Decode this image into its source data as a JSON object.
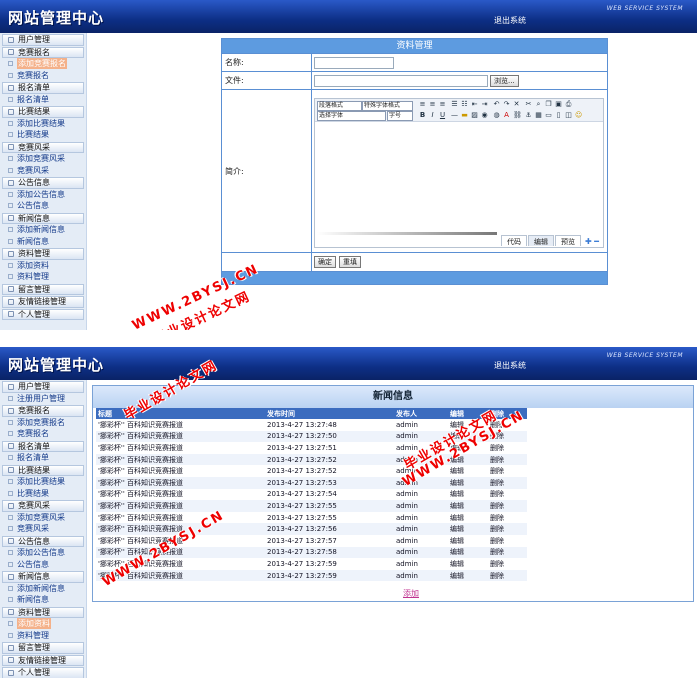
{
  "header": {
    "title": "网站管理中心",
    "logout": "退出系统",
    "system": "WEB SERVICE SYSTEM"
  },
  "sidebar_top": [
    {
      "type": "group",
      "label": "用户管理"
    },
    {
      "type": "group",
      "label": "竞赛报名"
    },
    {
      "type": "link",
      "label": "添加竞赛报名",
      "active": true
    },
    {
      "type": "link",
      "label": "竞赛报名"
    },
    {
      "type": "group",
      "label": "报名清单"
    },
    {
      "type": "link",
      "label": "报名清单"
    },
    {
      "type": "group",
      "label": "比赛结果"
    },
    {
      "type": "link",
      "label": "添加比赛结果"
    },
    {
      "type": "link",
      "label": "比赛结果"
    },
    {
      "type": "group",
      "label": "竞赛风采"
    },
    {
      "type": "link",
      "label": "添加竞赛风采"
    },
    {
      "type": "link",
      "label": "竞赛风采"
    },
    {
      "type": "group",
      "label": "公告信息"
    },
    {
      "type": "link",
      "label": "添加公告信息"
    },
    {
      "type": "link",
      "label": "公告信息"
    },
    {
      "type": "group",
      "label": "新闻信息"
    },
    {
      "type": "link",
      "label": "添加新闻信息"
    },
    {
      "type": "link",
      "label": "新闻信息"
    },
    {
      "type": "group",
      "label": "资料管理"
    },
    {
      "type": "link",
      "label": "添加资料"
    },
    {
      "type": "link",
      "label": "资料管理"
    },
    {
      "type": "group",
      "label": "留言管理"
    },
    {
      "type": "group",
      "label": "友情链接管理"
    },
    {
      "type": "group",
      "label": "个人管理"
    }
  ],
  "sidebar_bottom": [
    {
      "type": "group",
      "label": "用户管理"
    },
    {
      "type": "link",
      "label": "注册用户管理"
    },
    {
      "type": "group",
      "label": "竞赛报名"
    },
    {
      "type": "link",
      "label": "添加竞赛报名"
    },
    {
      "type": "link",
      "label": "竞赛报名"
    },
    {
      "type": "group",
      "label": "报名清单"
    },
    {
      "type": "link",
      "label": "报名清单"
    },
    {
      "type": "group",
      "label": "比赛结果"
    },
    {
      "type": "link",
      "label": "添加比赛结果"
    },
    {
      "type": "link",
      "label": "比赛结果"
    },
    {
      "type": "group",
      "label": "竞赛风采"
    },
    {
      "type": "link",
      "label": "添加竞赛风采"
    },
    {
      "type": "link",
      "label": "竞赛风采"
    },
    {
      "type": "group",
      "label": "公告信息"
    },
    {
      "type": "link",
      "label": "添加公告信息"
    },
    {
      "type": "link",
      "label": "公告信息"
    },
    {
      "type": "group",
      "label": "新闻信息"
    },
    {
      "type": "link",
      "label": "添加新闻信息"
    },
    {
      "type": "link",
      "label": "新闻信息"
    },
    {
      "type": "group",
      "label": "资料管理"
    },
    {
      "type": "link",
      "label": "添加资料",
      "active": true
    },
    {
      "type": "link",
      "label": "资料管理"
    },
    {
      "type": "group",
      "label": "留言管理"
    },
    {
      "type": "group",
      "label": "友情链接管理"
    },
    {
      "type": "group",
      "label": "个人管理"
    }
  ],
  "form": {
    "title": "资料管理",
    "name_label": "名称:",
    "file_label": "文件:",
    "browse": "浏览...",
    "intro_label": "简介:",
    "editor": {
      "para_format": "段落格式",
      "special_font": "特殊字体格式",
      "font_family": "选择字体",
      "font_size": "字号",
      "tabs": [
        "代码",
        "编辑",
        "预览"
      ]
    },
    "confirm": "确定",
    "reset": "重填"
  },
  "news": {
    "title": "新闻信息",
    "columns": [
      "标题",
      "发布时间",
      "发布人",
      "编辑",
      "删除"
    ],
    "rows": [
      [
        "'挪彩杯'' 百科知识竞赛报道",
        "2013-4-27 13:27:48",
        "admin",
        "编辑",
        "删除"
      ],
      [
        "'挪彩杯'' 百科知识竞赛报道",
        "2013-4-27 13:27:50",
        "admin",
        "编辑",
        "删除"
      ],
      [
        "'挪彩杯'' 百科知识竞赛报道",
        "2013-4-27 13:27:51",
        "admin",
        "编辑",
        "删除"
      ],
      [
        "'挪彩杯'' 百科知识竞赛报道",
        "2013-4-27 13:27:52",
        "admin",
        "编辑",
        "删除"
      ],
      [
        "'挪彩杯'' 百科知识竞赛报道",
        "2013-4-27 13:27:52",
        "admin",
        "编辑",
        "删除"
      ],
      [
        "'挪彩杯'' 百科知识竞赛报道",
        "2013-4-27 13:27:53",
        "admin",
        "编辑",
        "删除"
      ],
      [
        "'挪彩杯'' 百科知识竞赛报道",
        "2013-4-27 13:27:54",
        "admin",
        "编辑",
        "删除"
      ],
      [
        "'挪彩杯'' 百科知识竞赛报道",
        "2013-4-27 13:27:55",
        "admin",
        "编辑",
        "删除"
      ],
      [
        "'挪彩杯'' 百科知识竞赛报道",
        "2013-4-27 13:27:55",
        "admin",
        "编辑",
        "删除"
      ],
      [
        "'挪彩杯'' 百科知识竞赛报道",
        "2013-4-27 13:27:56",
        "admin",
        "编辑",
        "删除"
      ],
      [
        "'挪彩杯'' 百科知识竞赛报道",
        "2013-4-27 13:27:57",
        "admin",
        "编辑",
        "删除"
      ],
      [
        "'挪彩杯'' 百科知识竞赛报道",
        "2013-4-27 13:27:58",
        "admin",
        "编辑",
        "删除"
      ],
      [
        "'挪彩杯'' 百科知识竞赛报道",
        "2013-4-27 13:27:59",
        "admin",
        "编辑",
        "删除"
      ],
      [
        "'挪彩杯'' 百科知识竞赛报道",
        "2013-4-27 13:27:59",
        "admin",
        "编辑",
        "删除"
      ]
    ],
    "add": "添加"
  },
  "watermark": {
    "url": "WWW.2BYSJ.CN",
    "cn": "毕业设计论文网"
  }
}
